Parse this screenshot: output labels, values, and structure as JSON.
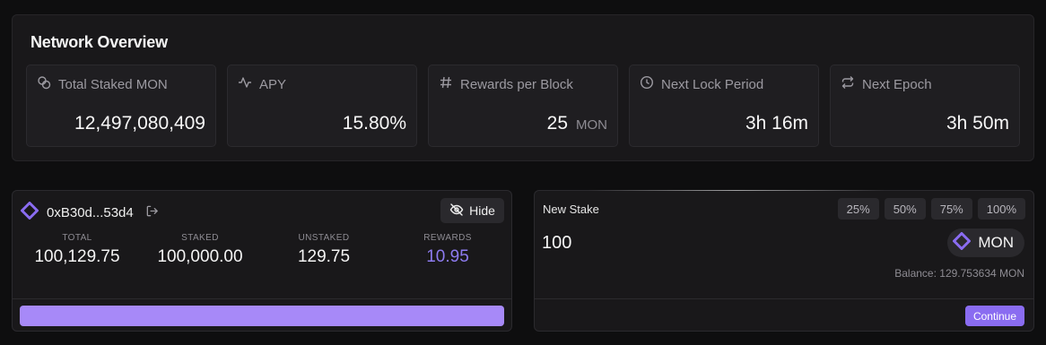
{
  "overview": {
    "title": "Network Overview",
    "stats": [
      {
        "label": "Total Staked MON",
        "value": "12,497,080,409",
        "unit": "",
        "icon": "coins-icon"
      },
      {
        "label": "APY",
        "value": "15.80%",
        "unit": "",
        "icon": "activity-icon"
      },
      {
        "label": "Rewards per Block",
        "value": "25",
        "unit": "MON",
        "icon": "hash-icon"
      },
      {
        "label": "Next Lock Period",
        "value": "3h 16m",
        "unit": "",
        "icon": "clock-icon"
      },
      {
        "label": "Next Epoch",
        "value": "3h 50m",
        "unit": "",
        "icon": "repeat-icon"
      }
    ]
  },
  "wallet": {
    "address": "0xB30d...53d4",
    "hide_label": "Hide",
    "balances": [
      {
        "label": "TOTAL",
        "value": "100,129.75"
      },
      {
        "label": "STAKED",
        "value": "100,000.00"
      },
      {
        "label": "UNSTAKED",
        "value": "129.75"
      },
      {
        "label": "REWARDS",
        "value": "10.95"
      }
    ]
  },
  "stake": {
    "title": "New Stake",
    "percent_options": [
      "25%",
      "50%",
      "75%",
      "100%"
    ],
    "amount": "100",
    "token": "MON",
    "balance_text": "Balance: 129.753634 MON",
    "continue_label": "Continue"
  },
  "colors": {
    "accent": "#8a6cf1",
    "accent_light": "#a789f8",
    "rewards": "#8d7bf0",
    "background": "#0e0e0f",
    "card": "#19181a"
  }
}
